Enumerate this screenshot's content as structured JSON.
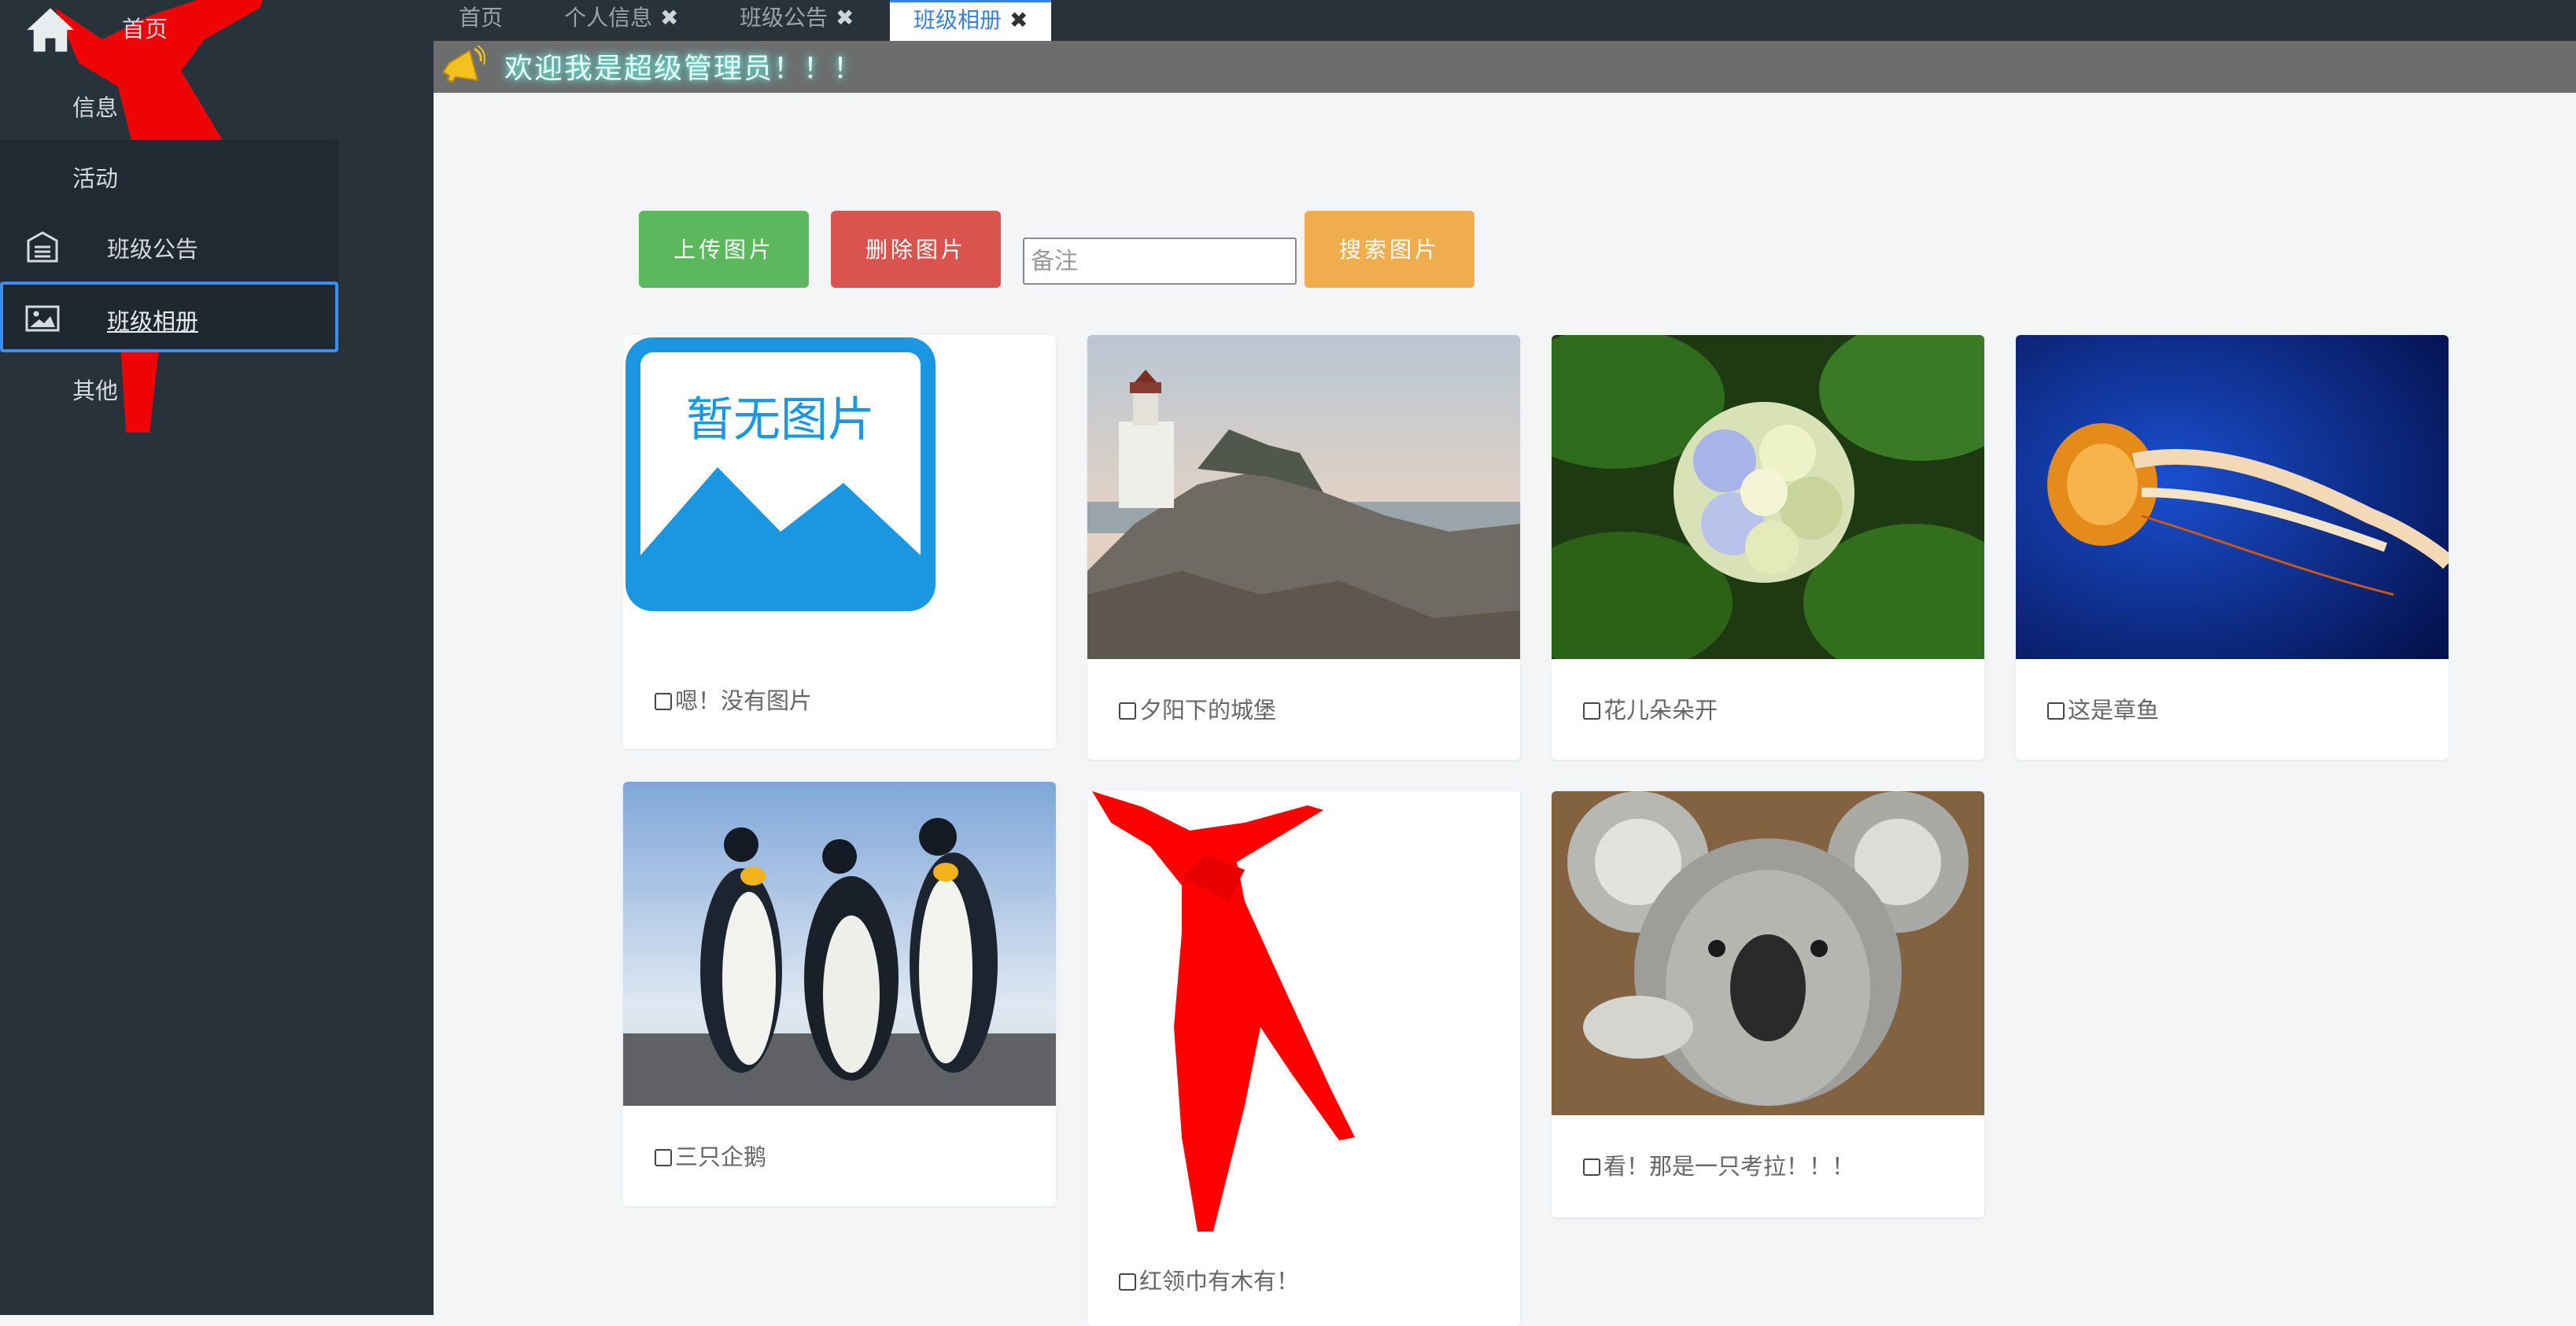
{
  "sidebar": {
    "items": [
      {
        "label": "首页",
        "icon": "home-icon"
      },
      {
        "label": "信息"
      },
      {
        "label": "活动"
      },
      {
        "label": "班级公告",
        "icon": "notice-icon"
      },
      {
        "label": "班级相册",
        "icon": "picture-icon"
      },
      {
        "label": "其他"
      }
    ]
  },
  "tabs": [
    {
      "label": "首页",
      "closable": false
    },
    {
      "label": "个人信息",
      "closable": true
    },
    {
      "label": "班级公告",
      "closable": true
    },
    {
      "label": "班级相册",
      "closable": true,
      "active": true
    }
  ],
  "close_symbol": "✖",
  "marquee": {
    "text": "欢迎我是超级管理员！！！",
    "icon": "speaker-icon"
  },
  "toolbar": {
    "upload_label": "上传图片",
    "delete_label": "删除图片",
    "remark_placeholder": "备注",
    "search_label": "搜索图片"
  },
  "photos": [
    {
      "caption": "嗯！没有图片",
      "placeholder_text": "暂无图片",
      "image": "no-image-placeholder"
    },
    {
      "caption": "夕阳下的城堡",
      "image": "lighthouse-photo"
    },
    {
      "caption": "花儿朵朵开",
      "image": "hydrangea-photo"
    },
    {
      "caption": "这是章鱼",
      "image": "jellyfish-photo"
    },
    {
      "caption": "三只企鹅",
      "image": "penguins-photo"
    },
    {
      "caption": "红领巾有木有！",
      "image": "red-scarf-image"
    },
    {
      "caption": "看！那是一只考拉！！！",
      "image": "koala-photo"
    }
  ],
  "colors": {
    "sidebar_bg": "#28323b",
    "upload": "#5cb85c",
    "delete": "#d9534f",
    "search": "#f0ad4e",
    "active_tab": "#3b7fd9",
    "selected_border": "#3b8ef0"
  }
}
